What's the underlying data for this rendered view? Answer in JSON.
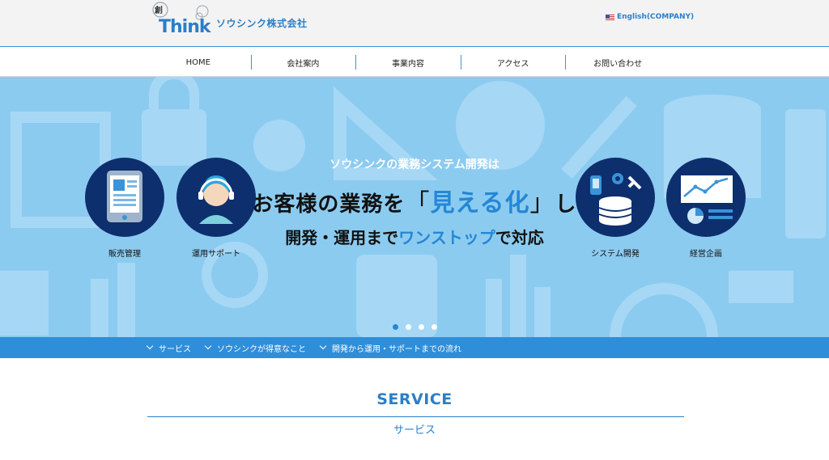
{
  "header": {
    "logo_mark": "創Think",
    "company_name": "ソウシンク株式会社",
    "language_link": "English(COMPANY)"
  },
  "nav": {
    "items": [
      {
        "label": "HOME"
      },
      {
        "label": "会社案内"
      },
      {
        "label": "事業内容"
      },
      {
        "label": "アクセス"
      },
      {
        "label": "お問い合わせ"
      }
    ]
  },
  "hero": {
    "subtitle": "ソウシンクの業務システム開発は",
    "headline_pre": "お客様の業務を",
    "headline_open": "「",
    "headline_highlight": "見える化",
    "headline_close": "」",
    "headline_post": "し",
    "third_pre": "開発・運用まで",
    "third_highlight": "ワンストップ",
    "third_post": "で対応",
    "circles": [
      {
        "label": "販売管理",
        "icon": "tablet-icon"
      },
      {
        "label": "運用サポート",
        "icon": "operator-headset-icon"
      },
      {
        "label": "システム開発",
        "icon": "database-gear-icon"
      },
      {
        "label": "経営企画",
        "icon": "chart-icon"
      }
    ],
    "slide_count": 4,
    "active_slide": 1,
    "colors": {
      "background": "#8ccbf0",
      "circle": "#0e2f6e",
      "highlight": "#2487d6"
    }
  },
  "anchors": [
    {
      "label": "サービス"
    },
    {
      "label": "ソウシンクが得意なこと"
    },
    {
      "label": "開発から運用・サポートまでの流れ"
    }
  ],
  "section": {
    "title": "SERVICE",
    "subtitle": "サービス"
  }
}
